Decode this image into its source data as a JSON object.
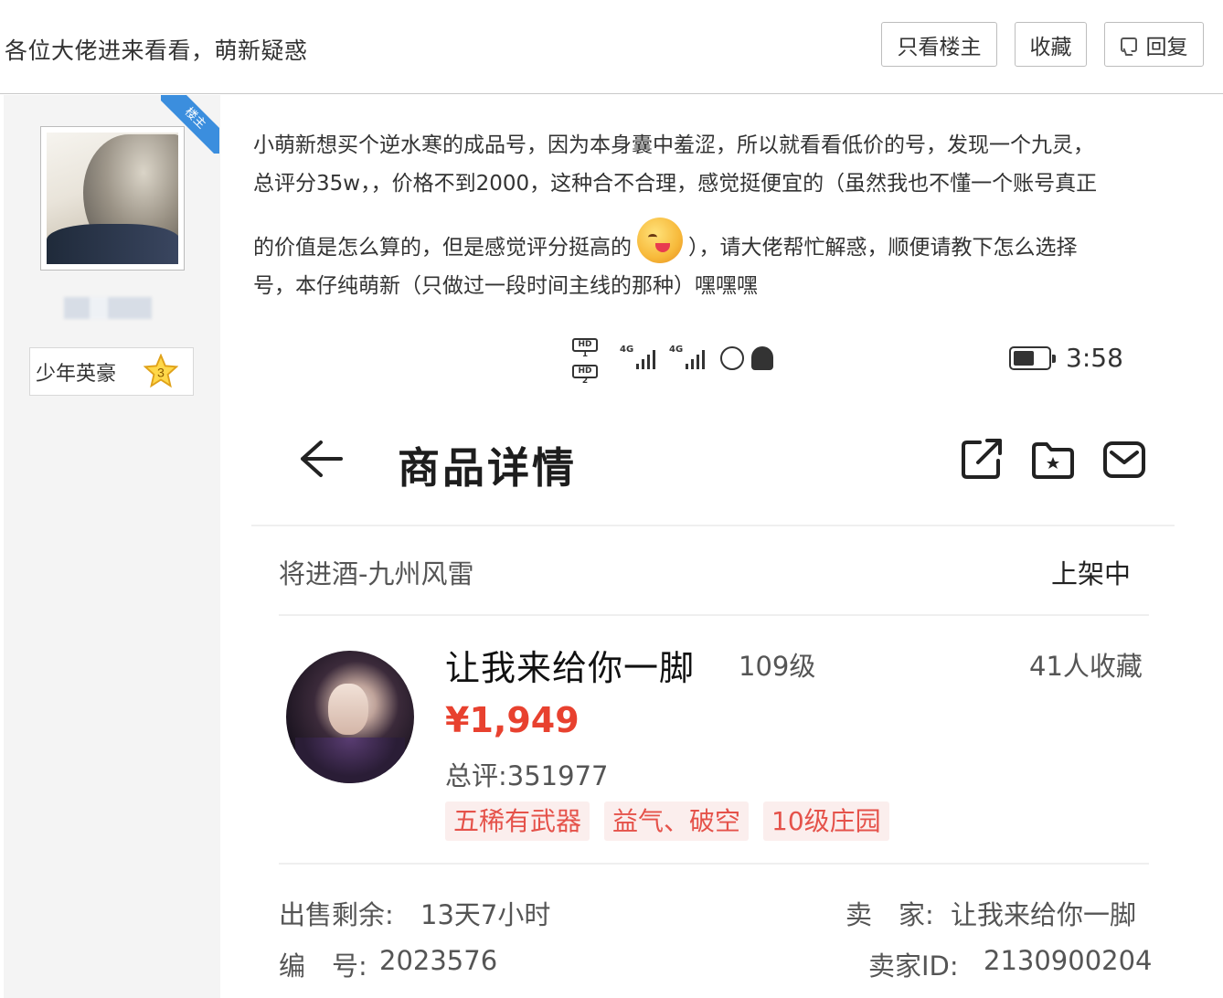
{
  "header": {
    "thread_title": "各位大佬进来看看，萌新疑惑",
    "buttons": {
      "only_owner": "只看楼主",
      "favorite": "收藏",
      "reply": "回复"
    }
  },
  "author": {
    "owner_badge": "楼主",
    "rank_title": "少年英豪",
    "rank_level": "3"
  },
  "post": {
    "line1": "小萌新想买个逆水寒的成品号，因为本身囊中羞涩，所以就看看低价的号，发现一个九灵，",
    "line2": "总评分35w，，价格不到2000，这种合不合理，感觉挺便宜的（虽然我也不懂一个账号真正",
    "line3a": "的价值是怎么算的，但是感觉评分挺高的",
    "line3b": "），请大佬帮忙解惑，顺便请教下怎么选择",
    "line4": "号，本仔纯萌新（只做过一段时间主线的那种）嘿嘿嘿"
  },
  "phone": {
    "status_time": "3:58",
    "status_4g_1": "4G",
    "status_4g_2": "4G",
    "hd1": "HD 1",
    "hd2": "HD 2",
    "page_title": "商品详情",
    "server": "将进酒-九州风雷",
    "listing_status": "上架中",
    "character_name": "让我来给你一脚",
    "level": "109级",
    "favorites": "41人收藏",
    "price": "¥1,949",
    "score": "总评:351977",
    "tags": [
      "五稀有武器",
      "益气、破空",
      "10级庄园"
    ],
    "remaining_label": "出售剩余:",
    "remaining_value": "13天7小时",
    "seller_label": "卖　家:",
    "seller_value": "让我来给你一脚",
    "number_label": "编　号:",
    "number_value": "2023576",
    "seller_id_label": "卖家ID:",
    "seller_id_value": "2130900204"
  },
  "colors": {
    "price_red": "#e8412f",
    "tag_bg": "#fbeeed",
    "tag_text": "#e5524a",
    "owner_badge": "#3b8ede"
  }
}
